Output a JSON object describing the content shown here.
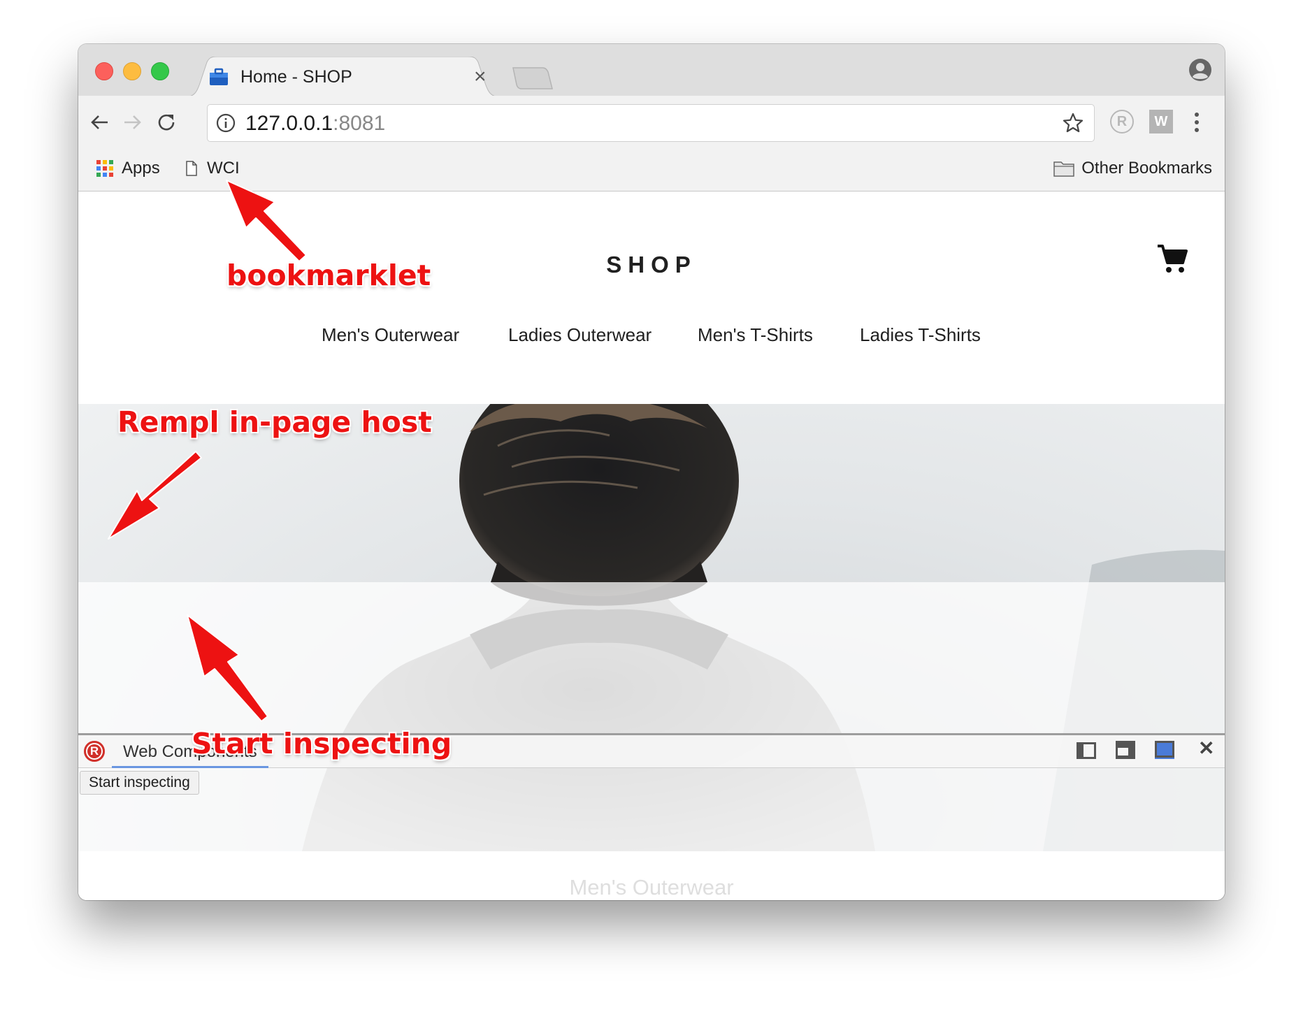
{
  "browser": {
    "tab": {
      "title": "Home - SHOP"
    },
    "address": {
      "host": "127.0.0.1",
      "port": ":8081"
    },
    "bookmarks": {
      "apps_label": "Apps",
      "wci_label": "WCI",
      "other_label": "Other Bookmarks"
    },
    "extensions": {
      "rempl_letter": "R",
      "w_letter": "W"
    }
  },
  "page": {
    "logo": "SHOP",
    "nav": [
      "Men's Outerwear",
      "Ladies Outerwear",
      "Men's T-Shirts",
      "Ladies T-Shirts"
    ],
    "footer_title": "Men's Outerwear"
  },
  "rempl": {
    "logo_letter": "R",
    "tab_label": "Web Components",
    "start_button": "Start inspecting",
    "active_layout": "bottom"
  },
  "annotations": {
    "bookmarklet": "bookmarklet",
    "host": "Rempl in-page host",
    "inspect": "Start inspecting"
  },
  "colors": {
    "annotation_red": "#ed1212",
    "active_layout_blue": "#4a7bd8",
    "tab_underline": "#6a96e0",
    "rempl_logo_red": "#d0302a"
  }
}
